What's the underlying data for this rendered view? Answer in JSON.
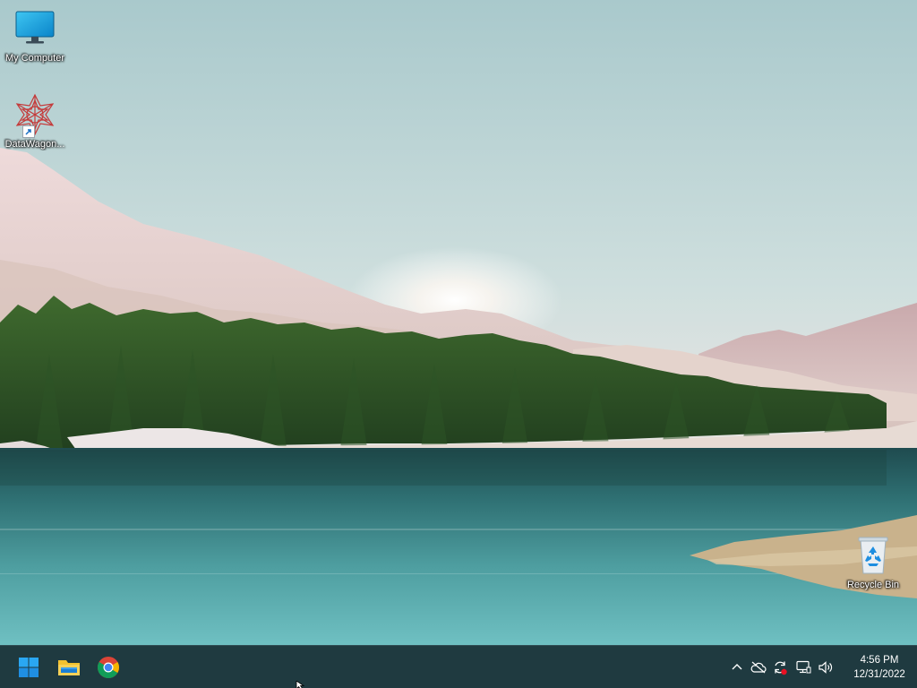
{
  "desktop": {
    "icons": [
      {
        "name": "my-computer",
        "label": "My Computer",
        "icon": "monitor-icon"
      },
      {
        "name": "datawagon",
        "label": "DataWagon...",
        "icon": "datawagon-icon"
      },
      {
        "name": "recycle-bin",
        "label": "Recycle Bin",
        "icon": "recycle-bin-icon"
      }
    ]
  },
  "taskbar": {
    "pinned": [
      {
        "name": "start",
        "icon": "windows-start-icon"
      },
      {
        "name": "file-explorer",
        "icon": "folder-icon"
      },
      {
        "name": "chrome",
        "icon": "chrome-icon"
      }
    ],
    "tray": [
      {
        "name": "show-hidden-icons",
        "icon": "chevron-up-icon"
      },
      {
        "name": "onedrive",
        "icon": "cloud-off-icon"
      },
      {
        "name": "update",
        "icon": "sync-icon"
      },
      {
        "name": "network",
        "icon": "network-icon"
      },
      {
        "name": "volume",
        "icon": "speaker-icon"
      }
    ],
    "clock": {
      "time": "4:56 PM",
      "date": "12/31/2022"
    }
  },
  "colors": {
    "taskbar_bg": "#1f3a40",
    "accent_blue": "#0078d4",
    "folder_yellow": "#f2c230"
  }
}
